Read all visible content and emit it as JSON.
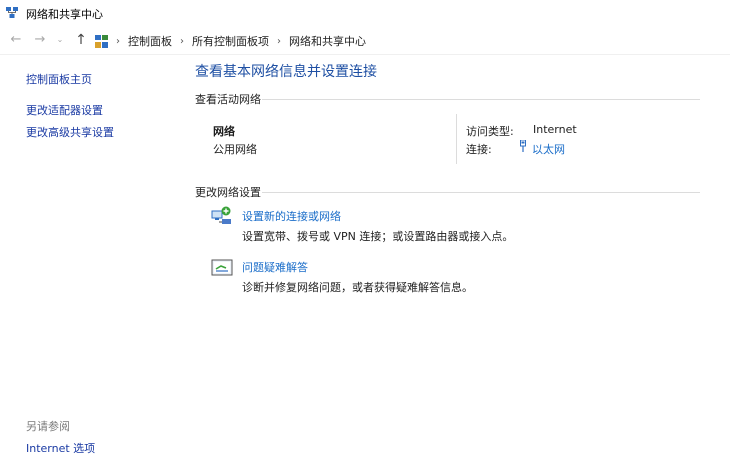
{
  "window": {
    "title": "网络和共享中心"
  },
  "nav": {
    "back_glyph": "←",
    "forward_glyph": "→",
    "recent_glyph": "⌄",
    "up_glyph": "↑",
    "separator": "›",
    "breadcrumbs": [
      "控制面板",
      "所有控制面板项",
      "网络和共享中心"
    ]
  },
  "sidebar": {
    "links": [
      "控制面板主页",
      "更改适配器设置",
      "更改高级共享设置"
    ],
    "see_also_heading": "另请参阅",
    "see_also_links": [
      "Internet 选项"
    ]
  },
  "main": {
    "title": "查看基本网络信息并设置连接",
    "active_section_heading": "查看活动网络",
    "network": {
      "name": "网络",
      "category": "公用网络",
      "access_type_label": "访问类型:",
      "access_type_value": "Internet",
      "connections_label": "连接:",
      "connection_value": "以太网"
    },
    "change_section_heading": "更改网络设置",
    "tasks": [
      {
        "link": "设置新的连接或网络",
        "desc": "设置宽带、拨号或 VPN 连接；或设置路由器或接入点。",
        "icon": "network-setup-icon"
      },
      {
        "link": "问题疑难解答",
        "desc": "诊断并修复网络问题，或者获得疑难解答信息。",
        "icon": "troubleshoot-icon"
      }
    ]
  },
  "colors": {
    "link": "#1a6dc9",
    "nav_link": "#1a3aa3",
    "title": "#1e4fa3",
    "muted": "#7a7a7a"
  }
}
